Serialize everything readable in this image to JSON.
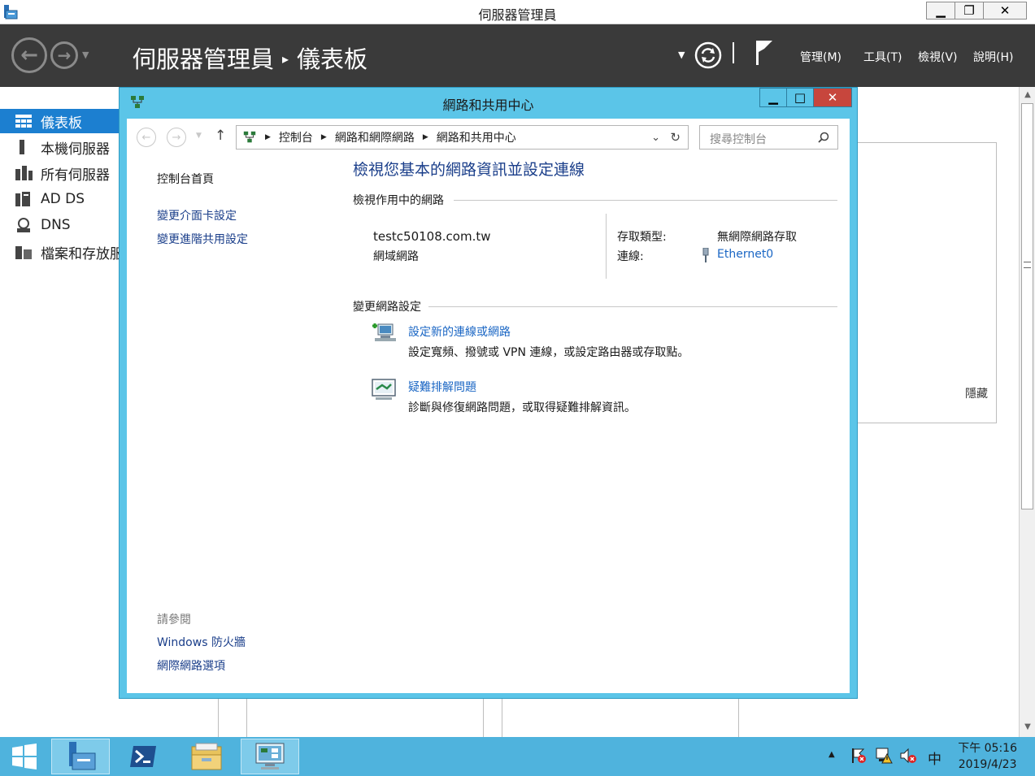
{
  "server_manager": {
    "window_title": "伺服器管理員",
    "breadcrumb": {
      "root": "伺服器管理員",
      "separator": "▸",
      "current": "儀表板"
    },
    "menu": {
      "manage": "管理(M)",
      "tools": "工具(T)",
      "view": "檢視(V)",
      "help": "說明(H)"
    },
    "sidebar": [
      {
        "label": "儀表板",
        "icon": "dashboard-icon",
        "active": true
      },
      {
        "label": "本機伺服器",
        "icon": "local-server-icon"
      },
      {
        "label": "所有伺服器",
        "icon": "all-servers-icon"
      },
      {
        "label": "AD DS",
        "icon": "ad-ds-icon"
      },
      {
        "label": "DNS",
        "icon": "dns-icon"
      },
      {
        "label": "檔案和存放服",
        "icon": "file-storage-icon"
      }
    ],
    "panel_hide": "隱藏"
  },
  "nsc": {
    "title": "網路和共用中心",
    "address": [
      "控制台",
      "網路和網際網路",
      "網路和共用中心"
    ],
    "search_placeholder": "搜尋控制台",
    "left_links": [
      "控制台首頁",
      "變更介面卡設定",
      "變更進階共用設定"
    ],
    "see_also": {
      "heading": "請參閱",
      "links": [
        "Windows 防火牆",
        "網際網路選項"
      ]
    },
    "heading": "檢視您基本的網路資訊並設定連線",
    "active_networks": {
      "title": "檢視作用中的網路",
      "name": "testc50108.com.tw",
      "category": "網域網路",
      "access_type_label": "存取類型:",
      "access_type_value": "無網際網路存取",
      "connections_label": "連線:",
      "connections_value": "Ethernet0"
    },
    "change_settings": {
      "title": "變更網路設定",
      "items": [
        {
          "link": "設定新的連線或網路",
          "desc": "設定寬頻、撥號或 VPN 連線，或設定路由器或存取點。"
        },
        {
          "link": "疑難排解問題",
          "desc": "診斷與修復網路問題，或取得疑難排解資訊。"
        }
      ]
    }
  },
  "taskbar": {
    "ime": "中",
    "time": "下午 05:16",
    "date": "2019/4/23"
  },
  "colors": {
    "header_bg": "#3a3a3a",
    "dialog_frame": "#5bc5e8",
    "active_nav": "#1c7fd0",
    "link_blue": "#1a3e8a",
    "taskbar": "#4fb3dd",
    "close_red": "#c7463d"
  }
}
